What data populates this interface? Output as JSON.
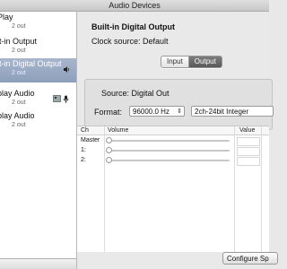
{
  "window": {
    "title": "Audio Devices"
  },
  "sidebar": {
    "items": [
      {
        "name": "Play",
        "io": "2 out",
        "icons": []
      },
      {
        "name": "lt-in Output",
        "io": "2 out",
        "icons": []
      },
      {
        "name": "lt-in Digital Output",
        "io": "2 out",
        "icons": [
          "speaker-icon"
        ],
        "selected": true
      },
      {
        "name": "play Audio",
        "io": "2 out",
        "icons": [
          "finder-icon",
          "microphone-icon"
        ]
      },
      {
        "name": "play Audio",
        "io": "2 out",
        "icons": []
      }
    ]
  },
  "device": {
    "title": "Built-in Digital Output",
    "clock_source_line": "Clock source:  Default"
  },
  "tabs": [
    {
      "label": "Input",
      "active": false
    },
    {
      "label": "Output",
      "active": true
    }
  ],
  "panel": {
    "source_line": "Source:  Digital Out",
    "format_label": "Format:",
    "sample_rate": "96000.0 Hz",
    "bit_format": "2ch-24bit Integer"
  },
  "table": {
    "headers": {
      "ch": "Ch",
      "volume": "Volume",
      "value": "Value"
    },
    "rows": [
      {
        "label": "Master",
        "level": 0
      },
      {
        "label": "1:",
        "level": 0
      },
      {
        "label": "2:",
        "level": 0
      }
    ]
  },
  "configure_button": "Configure Sp"
}
